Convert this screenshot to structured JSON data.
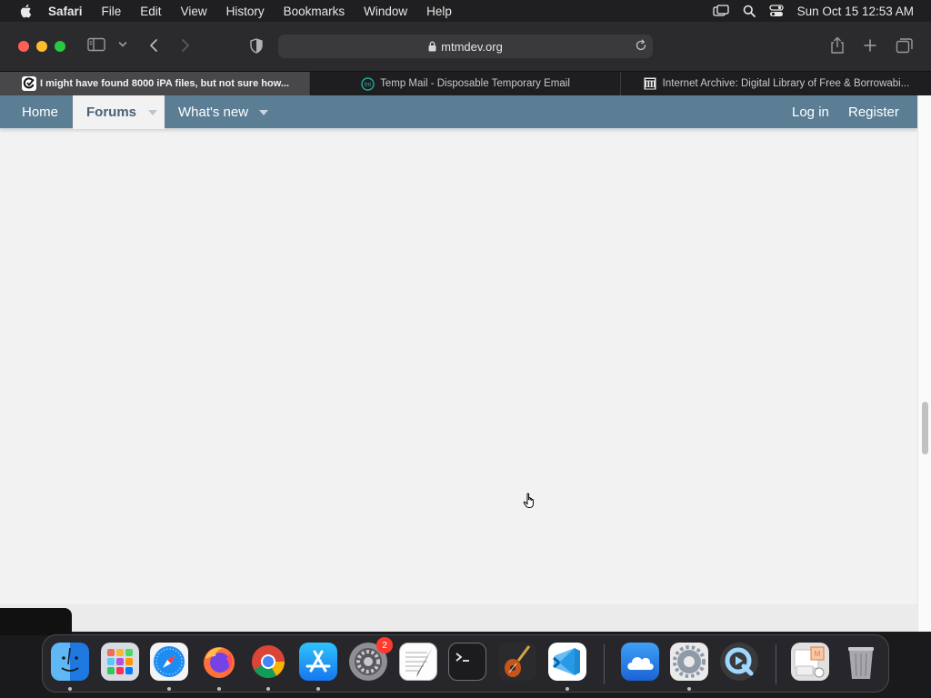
{
  "menubar": {
    "app_name": "Safari",
    "items": [
      "File",
      "Edit",
      "View",
      "History",
      "Bookmarks",
      "Window",
      "Help"
    ],
    "clock": "Sun Oct 15  12:53 AM"
  },
  "browser": {
    "url": "mtmdev.org",
    "tabs": [
      {
        "title": "I might have found 8000 iPA files, but not sure how...",
        "favicon": "mtmdev-icon",
        "active": true
      },
      {
        "title": "Temp Mail - Disposable Temporary Email",
        "favicon": "temp-mail-icon",
        "active": false
      },
      {
        "title": "Internet Archive: Digital Library of Free & Borrowabi...",
        "favicon": "internet-archive-icon",
        "active": false
      }
    ]
  },
  "site_nav": {
    "home": "Home",
    "forums": "Forums",
    "whats_new": "What's new",
    "login": "Log in",
    "register": "Register"
  },
  "dock": {
    "apps": [
      "Finder",
      "Launchpad",
      "Safari",
      "Firefox",
      "Google Chrome",
      "App Store",
      "System Preferences",
      "TextEdit",
      "Terminal",
      "GarageBand",
      "Visual Studio Code",
      "iCloud Drive",
      "Settings",
      "QuickTime Player"
    ],
    "system_preferences_badge": "2"
  },
  "colors": {
    "nav_bar": "#5b7e95",
    "nav_selected_text": "#47627a",
    "page_background": "#f2f2f2"
  }
}
